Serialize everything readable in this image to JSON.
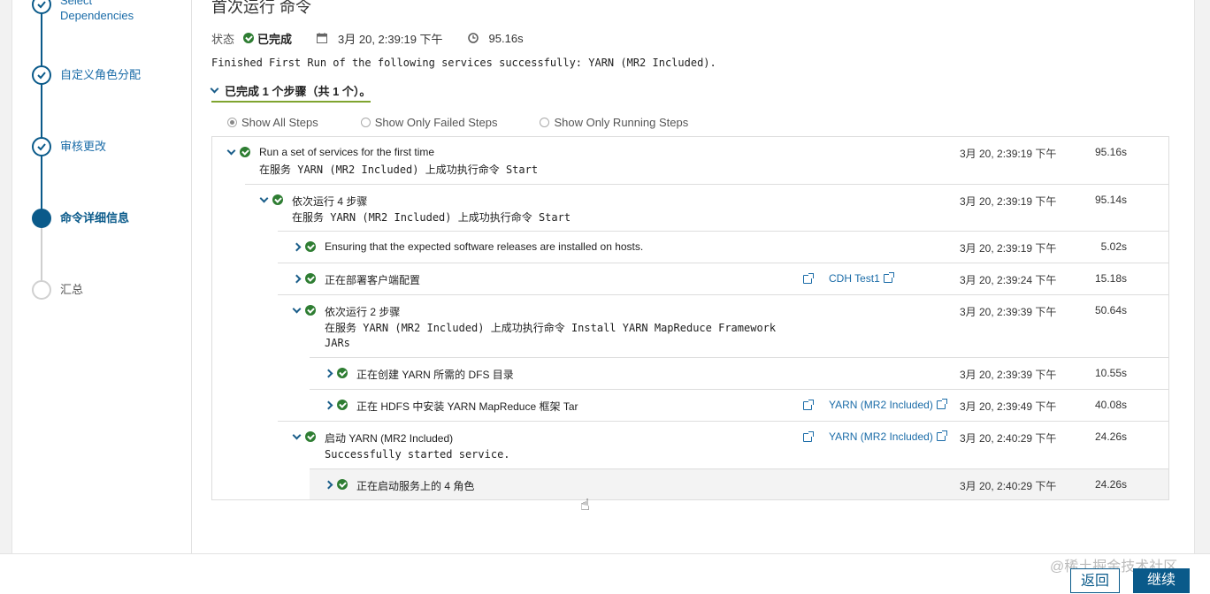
{
  "sidebar": {
    "steps": [
      {
        "label": "Select\nDependencies",
        "line1": "Select",
        "line2": "Dependencies",
        "state": "done"
      },
      {
        "label": "自定义角色分配",
        "state": "done"
      },
      {
        "label": "审核更改",
        "state": "done"
      },
      {
        "label": "命令详细信息",
        "state": "current"
      },
      {
        "label": "汇总",
        "state": "pending"
      }
    ]
  },
  "main": {
    "title": "首次运行 命令",
    "status_label": "状态",
    "status_value": "已完成",
    "date": "3月 20, 2:39:19 下午",
    "duration": "95.16s",
    "message": "Finished First Run of the following services successfully: YARN (MR2 Included).",
    "steps_toggle": "已完成 1 个步骤（共 1 个）。",
    "filters": [
      {
        "label": "Show All Steps",
        "selected": true
      },
      {
        "label": "Show Only Failed Steps",
        "selected": false
      },
      {
        "label": "Show Only Running Steps",
        "selected": false
      }
    ],
    "rows": [
      {
        "name": "Run a set of services for the first time",
        "detail": "在服务 YARN (MR2 Included) 上成功执行命令 Start",
        "time": "3月 20, 2:39:19 下午",
        "dur": "95.16s",
        "expanded": true
      },
      {
        "name": "依次运行 4 步骤",
        "detail": "在服务 YARN (MR2 Included) 上成功执行命令 Start",
        "time": "3月 20, 2:39:19 下午",
        "dur": "95.14s",
        "expanded": true
      },
      {
        "name": "Ensuring that the expected software releases are installed on hosts.",
        "time": "3月 20, 2:39:19 下午",
        "dur": "5.02s",
        "expanded": false
      },
      {
        "name": "正在部署客户端配置",
        "link": "CDH Test1",
        "time": "3月 20, 2:39:24 下午",
        "dur": "15.18s",
        "expanded": false
      },
      {
        "name": "依次运行 2 步骤",
        "detail": "在服务 YARN (MR2 Included) 上成功执行命令 Install YARN MapReduce Framework\nJARs",
        "time": "3月 20, 2:39:39 下午",
        "dur": "50.64s",
        "expanded": true
      },
      {
        "name": "正在创建 YARN 所需的 DFS 目录",
        "time": "3月 20, 2:39:39 下午",
        "dur": "10.55s",
        "expanded": false
      },
      {
        "name": "正在 HDFS 中安装 YARN MapReduce 框架 Tar",
        "link": "YARN (MR2 Included)",
        "time": "3月 20, 2:39:49 下午",
        "dur": "40.08s",
        "expanded": false
      },
      {
        "name": "启动 YARN (MR2 Included)",
        "detail": "Successfully started service.",
        "link": "YARN (MR2 Included)",
        "time": "3月 20, 2:40:29 下午",
        "dur": "24.26s",
        "expanded": true
      },
      {
        "name": "正在启动服务上的 4 角色",
        "time": "3月 20, 2:40:29 下午",
        "dur": "24.26s",
        "expanded": false
      }
    ]
  },
  "footer": {
    "back_label": "返回",
    "next_label": "继续",
    "watermark": "@稀土掘金技术社区"
  },
  "colors": {
    "accent": "#0a5a8a",
    "success": "#2e7d32",
    "link": "#1b6ca8"
  }
}
